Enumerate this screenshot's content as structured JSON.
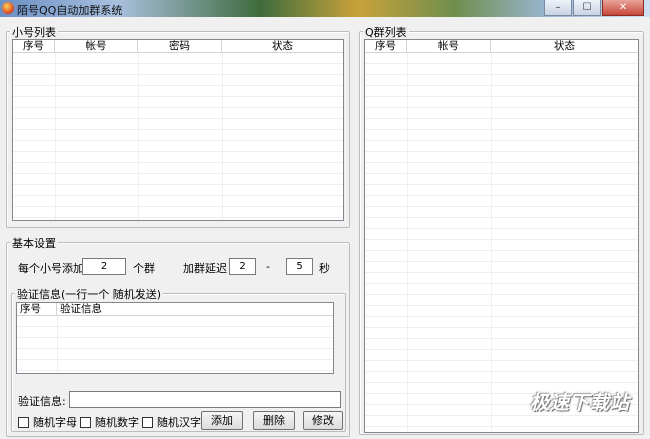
{
  "window": {
    "title": "陌号QQ自动加群系统",
    "controls": {
      "minimize": "–",
      "maximize": "☐",
      "close": "✕"
    }
  },
  "accounts_panel": {
    "legend": "小号列表",
    "columns": [
      "序号",
      "帐号",
      "密码",
      "状态"
    ],
    "rows": []
  },
  "groups_panel": {
    "legend": "Q群列表",
    "columns": [
      "序号",
      "帐号",
      "状态"
    ],
    "rows": []
  },
  "settings": {
    "legend": "基本设置",
    "per_account_label": "每个小号添加",
    "per_account_value": "2",
    "per_account_unit": "个群",
    "delay_label": "加群延迟",
    "delay_min": "2",
    "delay_sep": "-",
    "delay_max": "5",
    "delay_unit": "秒"
  },
  "verify": {
    "legend": "验证信息(一行一个 随机发送)",
    "columns": [
      "序号",
      "验证信息"
    ],
    "rows": [],
    "input_label": "验证信息:",
    "input_value": "",
    "checks": [
      {
        "label": "随机字母",
        "checked": false
      },
      {
        "label": "随机数字",
        "checked": false
      },
      {
        "label": "随机汉字",
        "checked": false
      }
    ],
    "buttons": {
      "add": "添加",
      "delete": "删除",
      "edit": "修改"
    }
  },
  "watermark": "极速下载站"
}
